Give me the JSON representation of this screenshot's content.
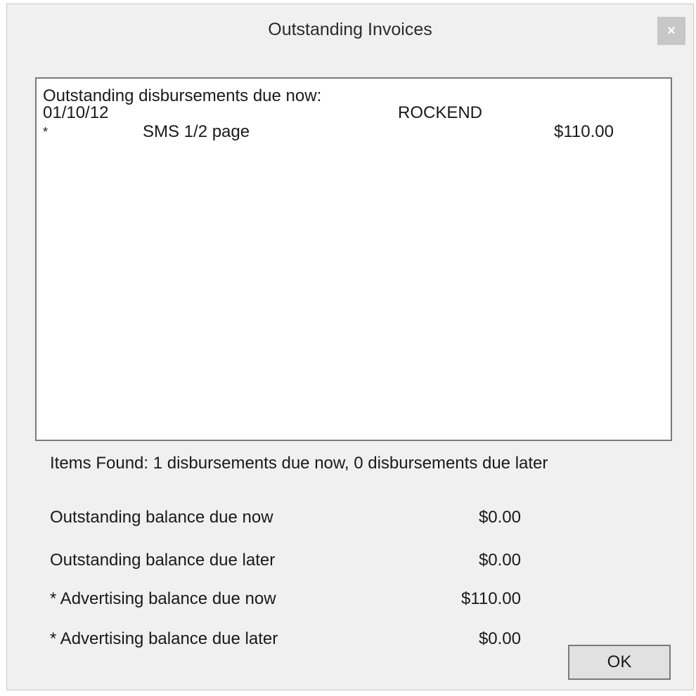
{
  "window": {
    "title": "Outstanding Invoices",
    "close_glyph": "×"
  },
  "listbox": {
    "heading": "Outstanding disbursements due now:",
    "entries": [
      {
        "date": "01/10/12",
        "supplier": "ROCKEND"
      },
      {
        "marker": "*",
        "description": "SMS 1/2 page",
        "amount": "$110.00"
      }
    ]
  },
  "items_found": "Items Found: 1 disbursements due now, 0 disbursements due later",
  "balances": [
    {
      "label": "Outstanding balance due now",
      "value": "$0.00"
    },
    {
      "label": "Outstanding balance due later",
      "value": "$0.00"
    },
    {
      "label": "* Advertising balance due now",
      "value": "$110.00"
    },
    {
      "label": "* Advertising balance due later",
      "value": "$0.00"
    }
  ],
  "buttons": {
    "ok_label": "OK"
  },
  "icons": {
    "close": "close-icon"
  },
  "colors": {
    "window_bg": "#f0f0f0",
    "list_bg": "#ffffff",
    "close_bg": "#c7c7c7",
    "button_bg": "#e1e1e1",
    "border": "#7a7a7a"
  }
}
